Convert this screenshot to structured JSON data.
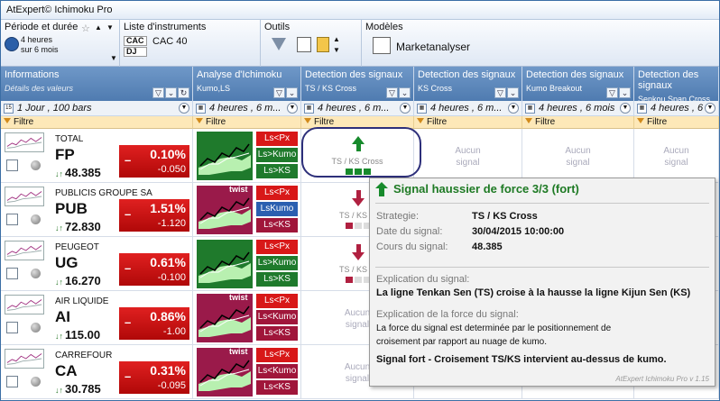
{
  "app": {
    "title": "AtExpert© Ichimoku Pro"
  },
  "ribbon": {
    "period_title": "Période et durée",
    "period_value": "4 heures",
    "period_sub": "sur 6 mois",
    "instruments_title": "Liste d'instruments",
    "instruments": [
      "CAC",
      "DJ"
    ],
    "selected_instrument": "CAC 40",
    "tools_title": "Outils",
    "models_title": "Modèles",
    "model_name": "Marketanalyser"
  },
  "columns": [
    {
      "title": "Informations",
      "subtitle": "Détails des valeurs",
      "selector": "1 Jour , 100 bars",
      "filter": "Filtre"
    },
    {
      "title": "Analyse d'Ichimoku",
      "subtitle": "Kumo,LS",
      "selector": "4 heures , 6 m...",
      "filter": "Filtre"
    },
    {
      "title": "Detection des signaux",
      "subtitle": "TS / KS Cross",
      "selector": "4 heures , 6 m...",
      "filter": "Filtre"
    },
    {
      "title": "Detection des signaux",
      "subtitle": "KS Cross",
      "selector": "4 heures , 6 m...",
      "filter": "Filtre"
    },
    {
      "title": "Detection des signaux",
      "subtitle": "Kumo Breakout",
      "selector": "4 heures , 6 mois",
      "filter": "Filtre"
    },
    {
      "title": "Detection des signaux",
      "subtitle": "Senkou Span Cross",
      "selector": "4 heures , 6 m",
      "filter": "Filtre"
    }
  ],
  "rows": [
    {
      "name": "TOTAL",
      "ticker": "FP",
      "price": "48.385",
      "pct": "0.10%",
      "abs": "-0.050",
      "twist": "",
      "tags": [
        "Ls<Px",
        "Ls>Kumo",
        "Ls>KS"
      ],
      "sig1": "up",
      "sig1_label": "TS / KS Cross",
      "sig2": "Aucun signal",
      "sig3": "Aucun signal",
      "sig4": "Aucun signal"
    },
    {
      "name": "PUBLICIS GROUPE SA",
      "ticker": "PUB",
      "price": "72.830",
      "pct": "1.51%",
      "abs": "-1.120",
      "twist": "twist",
      "tags": [
        "Ls<Px",
        "LsKumo",
        "Ls<KS"
      ],
      "sig1": "down",
      "sig1_label": "TS / KS C",
      "sig2": "",
      "sig3": "",
      "sig4": ""
    },
    {
      "name": "PEUGEOT",
      "ticker": "UG",
      "price": "16.270",
      "pct": "0.61%",
      "abs": "-0.100",
      "twist": "",
      "tags": [
        "Ls<Px",
        "Ls>Kumo",
        "Ls>KS"
      ],
      "sig1": "down",
      "sig1_label": "TS / KS C",
      "sig2": "",
      "sig3": "",
      "sig4": ""
    },
    {
      "name": "AIR LIQUIDE",
      "ticker": "AI",
      "price": "115.00",
      "pct": "0.86%",
      "abs": "-1.00",
      "twist": "twist",
      "tags": [
        "Ls<Px",
        "Ls<Kumo",
        "Ls<KS"
      ],
      "sig1": "Aucun signal",
      "sig1_label": "",
      "sig2": "",
      "sig3": "",
      "sig4": ""
    },
    {
      "name": "CARREFOUR",
      "ticker": "CA",
      "price": "30.785",
      "pct": "0.31%",
      "abs": "-0.095",
      "twist": "twist",
      "tags": [
        "Ls<Px",
        "Ls<Kumo",
        "Ls<KS"
      ],
      "sig1": "Aucun signal",
      "sig1_label": "",
      "sig2": "",
      "sig3": "",
      "sig4": ""
    }
  ],
  "tooltip": {
    "title": "Signal haussier de force 3/3 (fort)",
    "strategy_label": "Strategie:",
    "strategy": "TS / KS Cross",
    "date_label": "Date du signal:",
    "date": "30/04/2015 10:00:00",
    "price_label": "Cours du signal:",
    "price": "48.385",
    "expl_label": "Explication du signal:",
    "expl": "La ligne Tenkan Sen (TS) croise à la hausse la ligne Kijun Sen (KS)",
    "force_label": "Explication de la force du signal:",
    "force_1": "La force du signal est determinée par le positionnement de",
    "force_2": "croisement par rapport au nuage de kumo.",
    "strong": "Signal fort - Croisement TS/KS intervient au-dessus de kumo.",
    "version": "AtExpert Ichimoku Pro v 1.15"
  }
}
